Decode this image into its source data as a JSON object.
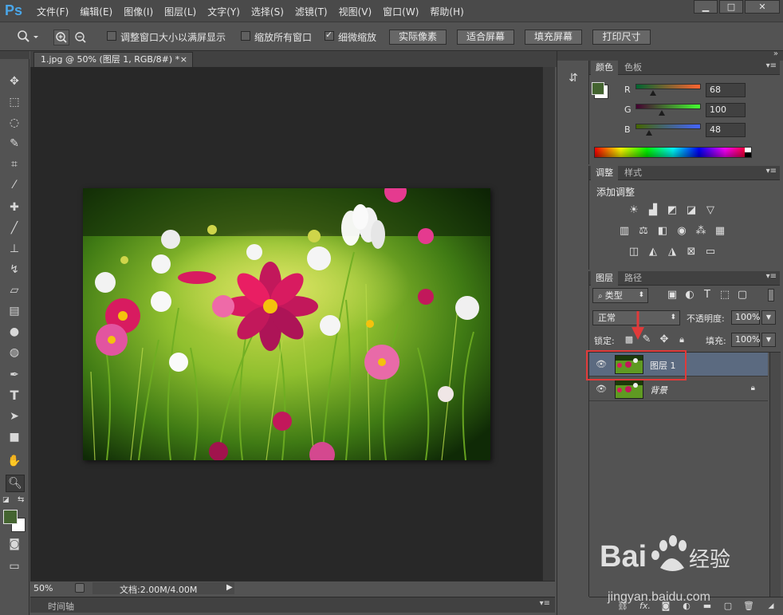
{
  "app": {
    "logo": "Ps",
    "menu": [
      "文件(F)",
      "编辑(E)",
      "图像(I)",
      "图层(L)",
      "文字(Y)",
      "选择(S)",
      "滤镜(T)",
      "视图(V)",
      "窗口(W)",
      "帮助(H)"
    ]
  },
  "options_bar": {
    "checkbox_fit_window": "调整窗口大小以满屏显示",
    "checkbox_zoom_all": "缩放所有窗口",
    "checkbox_scrubby": "细微缩放",
    "btn_actual_pixels": "实际像素",
    "btn_fit_screen": "适合屏幕",
    "btn_fill_screen": "填充屏幕",
    "btn_print_size": "打印尺寸"
  },
  "document": {
    "tab_title": "1.jpg @ 50% (图层 1, RGB/8#) *",
    "close_glyph": "×"
  },
  "status": {
    "zoom": "50%",
    "doc_info": "文档:2.00M/4.00M",
    "timeline": "时间轴"
  },
  "color_panel": {
    "tab_color": "颜色",
    "tab_swatches": "色板",
    "r_label": "R",
    "g_label": "G",
    "b_label": "B",
    "r": 68,
    "g": 100,
    "b": 48,
    "fg_color": "#446430"
  },
  "adjustments_panel": {
    "tab_adjust": "调整",
    "tab_styles": "样式",
    "heading": "添加调整"
  },
  "layers_panel": {
    "tab_layers": "图层",
    "tab_paths": "路径",
    "filter_kind": "类型",
    "blend_mode": "正常",
    "opacity_label": "不透明度:",
    "opacity_value": "100%",
    "lock_label": "锁定:",
    "fill_label": "填充:",
    "fill_value": "100%",
    "layers": [
      {
        "name": "图层 1",
        "selected": true,
        "locked": false
      },
      {
        "name": "背景",
        "selected": false,
        "locked": true
      }
    ]
  },
  "watermark": {
    "text": "jingyan.baidu.com"
  },
  "colors": {
    "highlight_red": "#e03a3a",
    "ps_blue": "#4aa6e8",
    "selected_layer": "#5b6a80"
  }
}
